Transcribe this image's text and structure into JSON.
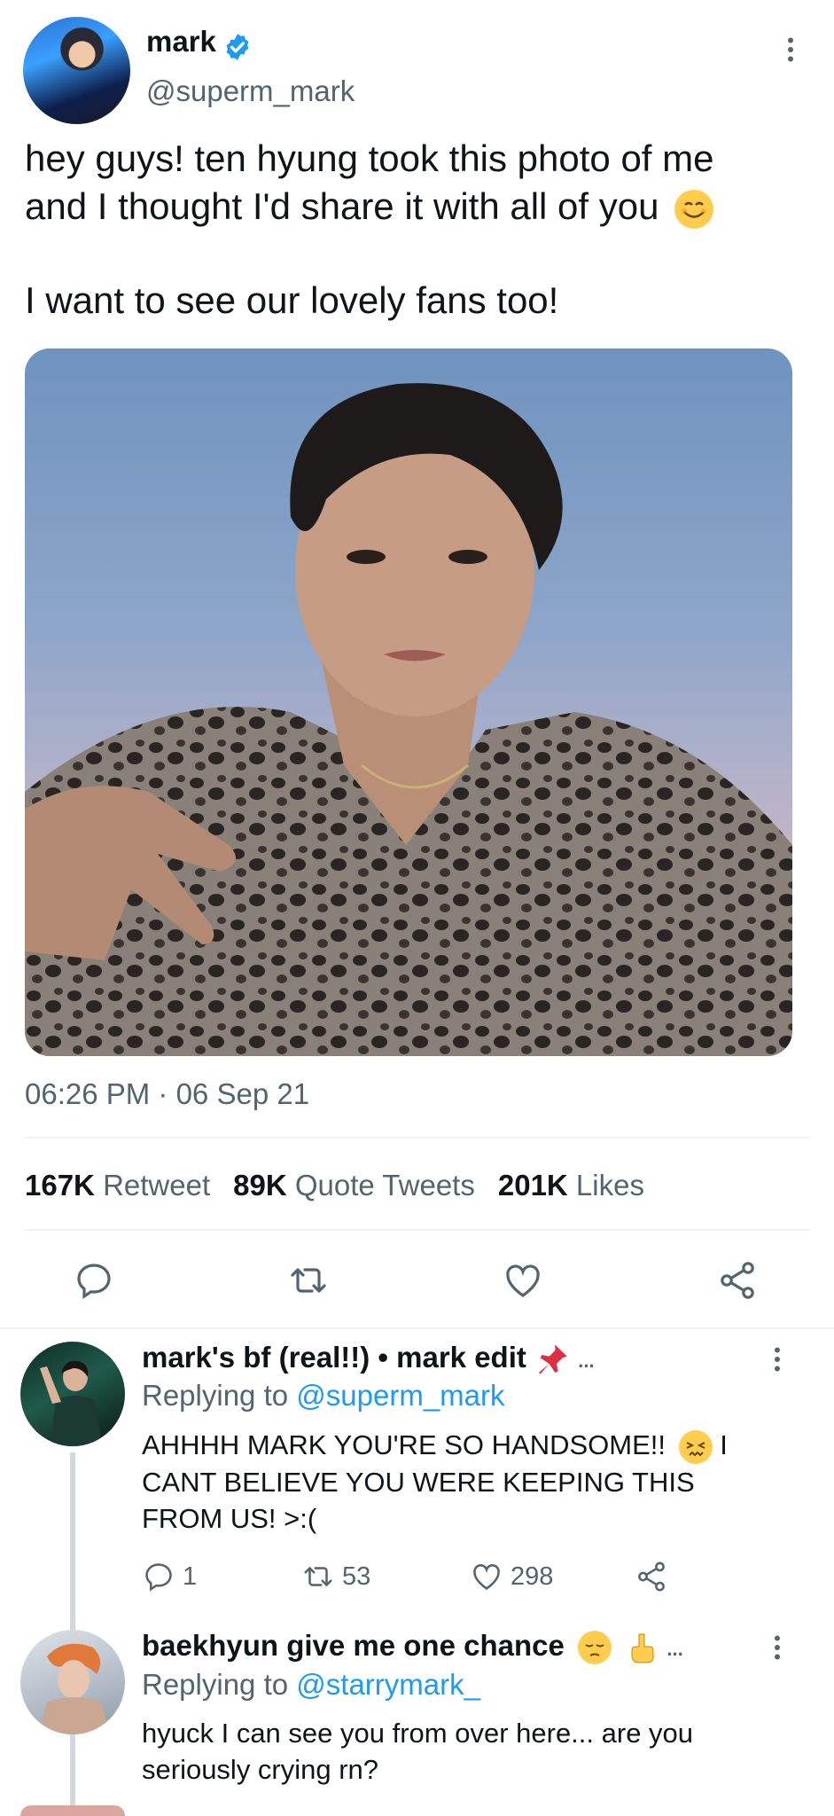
{
  "tweet": {
    "author_name": "mark",
    "author_handle": "@superm_mark",
    "text_line1": "hey guys! ten hyung took this photo of me",
    "text_line2": "and I thought I'd share it with all of you",
    "text_line3": "I want to see our lovely fans too!",
    "timestamp": "06:26 PM · 06 Sep 21",
    "stats": {
      "retweets_count": "167K",
      "retweets_label": "Retweet",
      "quotes_count": "89K",
      "quotes_label": "Quote Tweets",
      "likes_count": "201K",
      "likes_label": "Likes"
    },
    "icons": [
      "verified-badge-icon",
      "more-vertical-icon",
      "reply-icon",
      "retweet-icon",
      "like-icon",
      "share-icon"
    ]
  },
  "replies": [
    {
      "name": "mark's bf (real!!) • mark edit",
      "ellipsis": "...",
      "replying_prefix": "Replying to",
      "replying_to": "@superm_mark",
      "text_line1": "AHHHH MARK YOU'RE SO HANDSOME!!",
      "text_line1_tail": "I",
      "text_line2": "CANT BELIEVE YOU WERE KEEPING THIS",
      "text_line3": "FROM US! >:(",
      "reply_count": "1",
      "retweet_count": "53",
      "like_count": "298"
    },
    {
      "name": "baekhyun give me one chance",
      "ellipsis": "...",
      "replying_prefix": "Replying to",
      "replying_to": "@starrymark_",
      "text_line1": "hyuck I can see you from over here... are you",
      "text_line2": "seriously crying rn?"
    }
  ],
  "colors": {
    "accent": "#1d9bf0",
    "secondary_text": "#536471",
    "divider": "#eff3f4"
  }
}
